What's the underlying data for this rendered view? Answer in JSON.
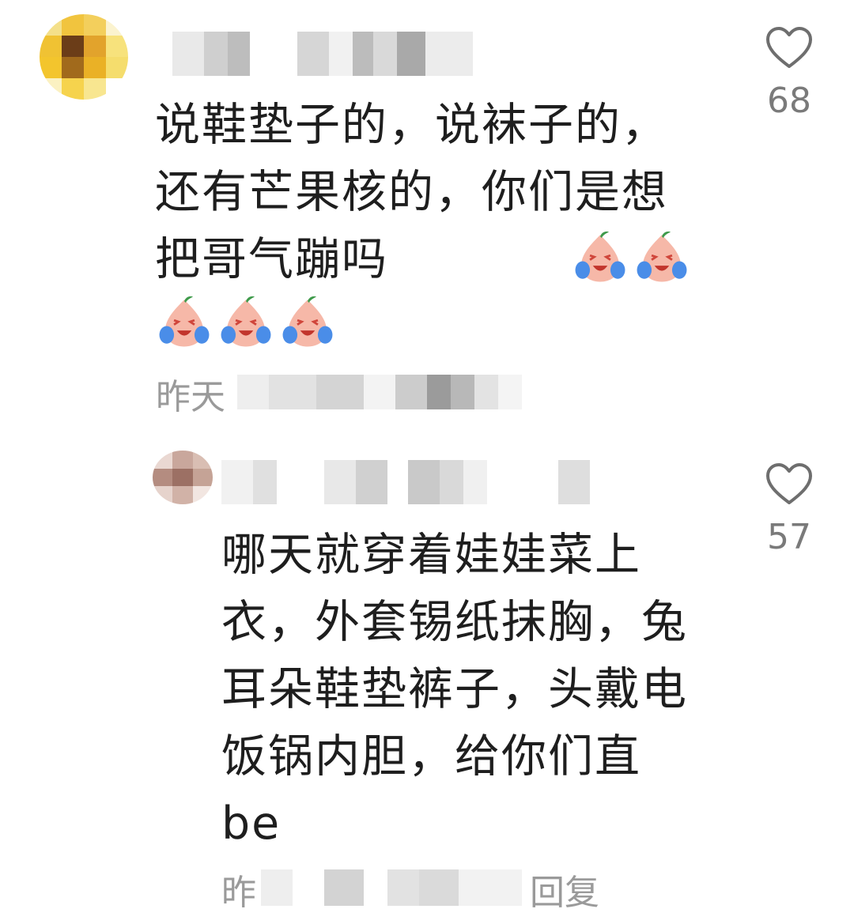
{
  "comments": [
    {
      "text": "说鞋垫子的，说袜子的，还有芒果核的，你们是想把哥气蹦吗",
      "emoji_count": 5,
      "emoji_name": "crying-laughing-peach-emoji",
      "meta_visible": "昨天",
      "like_count": "68"
    },
    {
      "text": "哪天就穿着娃娃菜上衣，外套锡纸抹胸，兔耳朵鞋垫裤子，头戴电饭锅内胆，给你们直be",
      "meta_visible": "昨",
      "reply_label": "回复",
      "like_count": "57"
    }
  ],
  "icons": {
    "like": "heart-outline-icon"
  },
  "colors": {
    "background": "#ffffff",
    "text": "#1e1e1e",
    "meta": "#9a9a9a",
    "like_icon": "#6e6e6e"
  }
}
